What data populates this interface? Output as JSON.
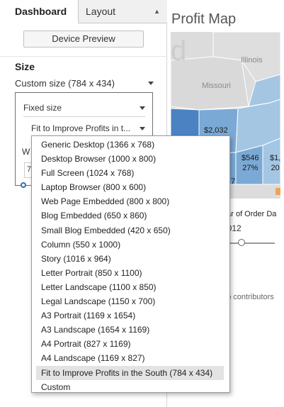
{
  "tabs": {
    "dashboard": "Dashboard",
    "layout": "Layout"
  },
  "device_preview_label": "Device Preview",
  "size": {
    "heading": "Size",
    "current": "Custom size (784 x 434)",
    "mode": "Fixed size",
    "preset": "Fit to Improve Profits in t...",
    "partial_w": "W",
    "partial_field": "7"
  },
  "dashboard_preview": {
    "title": "Profit Map",
    "map_partial_text": "d",
    "states": [
      "Illinois",
      "Missouri"
    ],
    "values": [
      {
        "label": "$2,032"
      },
      {
        "label": "$546",
        "pct": "27%"
      },
      {
        "label": "$1,",
        "pct": "20"
      },
      {
        "label": "7"
      }
    ],
    "filter_title": "ear of Order Da",
    "filter_value": "2012",
    "credit": "ap contributors"
  },
  "dropdown_options": [
    "Generic Desktop (1366 x 768)",
    "Desktop Browser (1000 x 800)",
    "Full Screen (1024 x 768)",
    "Laptop Browser (800 x 600)",
    "Web Page Embedded (800 x 800)",
    "Blog Embedded (650 x 860)",
    "Small Blog Embedded (420 x 650)",
    "Column (550 x 1000)",
    "Story (1016 x 964)",
    "Letter Portrait (850 x 1100)",
    "Letter Landscape (1100 x 850)",
    "Legal Landscape (1150 x 700)",
    "A3 Portrait (1169 x 1654)",
    "A3 Landscape (1654 x 1169)",
    "A4 Portrait (827 x 1169)",
    "A4 Landscape (1169 x 827)",
    "Fit to Improve Profits in the South (784 x 434)",
    "Custom"
  ],
  "selected_option_index": 16,
  "colors": {
    "map_blue_light": "#a4c6e3",
    "map_blue_mid": "#7aa9d6",
    "map_blue_dark": "#4a82c2",
    "map_orange": "#f0a35a",
    "map_background": "#dcdcdc",
    "accent": "#3a6ea5"
  }
}
